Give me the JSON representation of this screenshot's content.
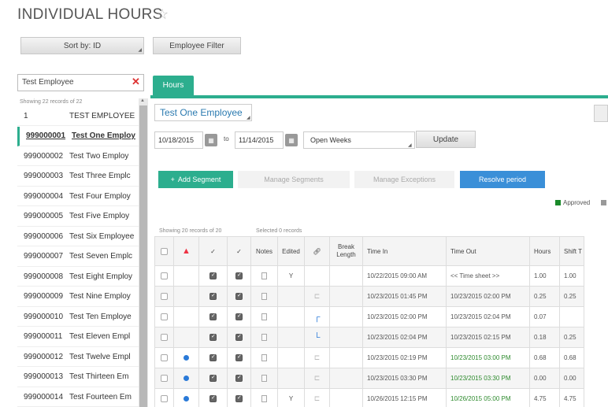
{
  "header": {
    "title": "INDIVIDUAL HOURS",
    "star_icon": "☆"
  },
  "toolbar": {
    "sort_label": "Sort by: ID",
    "filter_label": "Employee Filter"
  },
  "search": {
    "value": "Test Employee",
    "clear_icon": "✕"
  },
  "tabs": [
    {
      "label": "Hours"
    }
  ],
  "employee_list": {
    "count_text": "Showing 22 records of 22",
    "items": [
      {
        "id": "1",
        "name": "TEST EMPLOYEE"
      },
      {
        "id": "999000001",
        "name": "Test One Employ"
      },
      {
        "id": "999000002",
        "name": "Test Two Employ"
      },
      {
        "id": "999000003",
        "name": "Test Three Emplc"
      },
      {
        "id": "999000004",
        "name": "Test Four Employ"
      },
      {
        "id": "999000005",
        "name": "Test Five Employ"
      },
      {
        "id": "999000006",
        "name": "Test Six Employee"
      },
      {
        "id": "999000007",
        "name": "Test Seven Emplc"
      },
      {
        "id": "999000008",
        "name": "Test Eight Employ"
      },
      {
        "id": "999000009",
        "name": "Test Nine Employ"
      },
      {
        "id": "999000010",
        "name": "Test Ten Employe"
      },
      {
        "id": "999000011",
        "name": "Test Eleven Empl"
      },
      {
        "id": "999000012",
        "name": "Test Twelve Empl"
      },
      {
        "id": "999000013",
        "name": "Test Thirteen Em"
      },
      {
        "id": "999000014",
        "name": "Test Fourteen Em"
      }
    ],
    "selected_index": 1
  },
  "detail": {
    "employee": "Test One Employee",
    "start_date": "10/18/2015",
    "to_label": "to",
    "end_date": "11/14/2015",
    "period": "Open Weeks",
    "update_label": "Update",
    "add_segment_label": "Add Segment",
    "add_icon": "+",
    "manage_segments_label": "Manage Segments",
    "manage_exceptions_label": "Manage Exceptions",
    "resolve_label": "Resolve period",
    "legend_approved": "Approved",
    "legend_approved_color": "#1a8a2a"
  },
  "table": {
    "count_text": "Showing 20 records of 20",
    "selected_text": "Selected 0 records",
    "columns": [
      "",
      "bell-icon",
      "check-down-icon",
      "check-down-icon",
      "Notes",
      "Edited",
      "link-icon",
      "Break Length",
      "Time In",
      "Time Out",
      "Hours",
      "Shift T"
    ],
    "header_labels": {
      "notes": "Notes",
      "edited": "Edited",
      "break": "Break Length",
      "time_in": "Time In",
      "time_out": "Time Out",
      "hours": "Hours",
      "shift": "Shift T"
    },
    "rows": [
      {
        "dot": false,
        "c1": true,
        "c2": true,
        "edited": "Y",
        "link": "",
        "time_in": "10/22/2015 09:00 AM",
        "time_out": "<< Time sheet >>",
        "out_green": false,
        "hours": "1.00",
        "shift": "1.00"
      },
      {
        "dot": false,
        "c1": true,
        "c2": true,
        "edited": "",
        "link": "gray",
        "time_in": "10/23/2015 01:45 PM",
        "time_out": "10/23/2015 02:00 PM",
        "out_green": false,
        "hours": "0.25",
        "shift": "0.25"
      },
      {
        "dot": false,
        "c1": true,
        "c2": true,
        "edited": "",
        "link": "blue-top",
        "time_in": "10/23/2015 02:00 PM",
        "time_out": "10/23/2015 02:04 PM",
        "out_green": false,
        "hours": "0.07",
        "shift": ""
      },
      {
        "dot": false,
        "c1": true,
        "c2": true,
        "edited": "",
        "link": "blue-bottom",
        "time_in": "10/23/2015 02:04 PM",
        "time_out": "10/23/2015 02:15 PM",
        "out_green": false,
        "hours": "0.18",
        "shift": "0.25"
      },
      {
        "dot": true,
        "c1": true,
        "c2": true,
        "edited": "",
        "link": "gray",
        "time_in": "10/23/2015 02:19 PM",
        "time_out": "10/23/2015 03:00 PM",
        "out_green": true,
        "hours": "0.68",
        "shift": "0.68"
      },
      {
        "dot": true,
        "c1": true,
        "c2": true,
        "edited": "",
        "link": "gray",
        "time_in": "10/23/2015 03:30 PM",
        "time_out": "10/23/2015 03:30 PM",
        "out_green": true,
        "hours": "0.00",
        "shift": "0.00"
      },
      {
        "dot": true,
        "c1": true,
        "c2": true,
        "edited": "Y",
        "link": "gray",
        "time_in": "10/26/2015 12:15 PM",
        "time_out": "10/26/2015 05:00 PM",
        "out_green": true,
        "hours": "4.75",
        "shift": "4.75"
      }
    ]
  },
  "colors": {
    "accent": "#2cae8e",
    "primary": "#3a8fd8",
    "alert": "#ee3344",
    "time_green": "#2e8b2e"
  }
}
